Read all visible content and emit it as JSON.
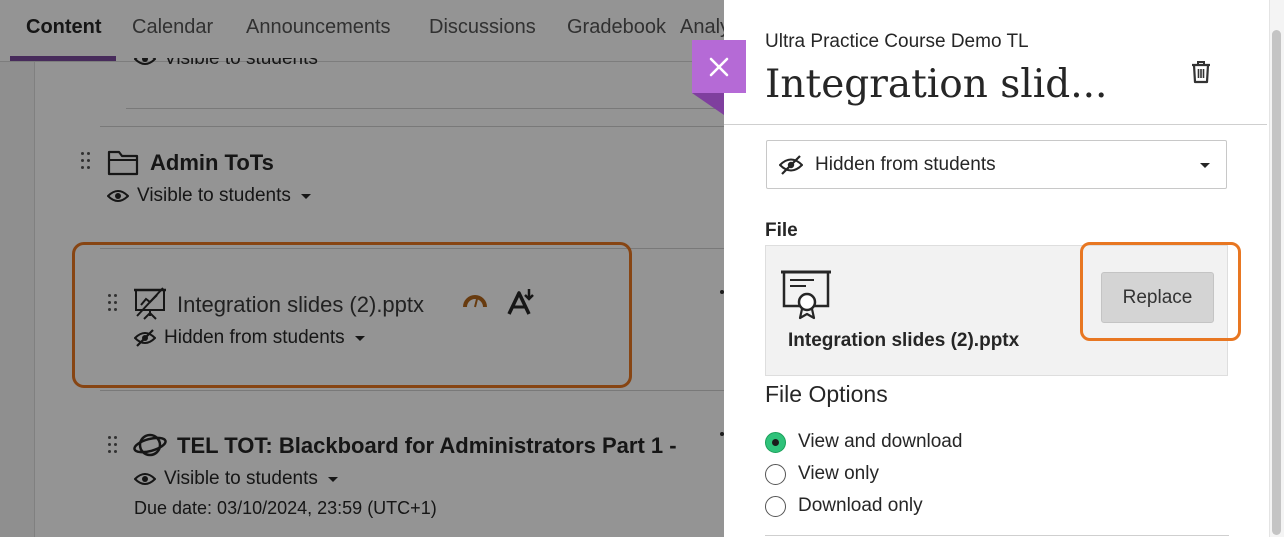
{
  "nav": {
    "tabs": [
      {
        "label": "Content"
      },
      {
        "label": "Calendar"
      },
      {
        "label": "Announcements"
      },
      {
        "label": "Discussions"
      },
      {
        "label": "Gradebook"
      },
      {
        "label": "Analy"
      }
    ]
  },
  "course_items": {
    "top_partial_visibility": "Visible to students",
    "rows": [
      {
        "title": "Admin ToTs",
        "visibility": "Visible to students"
      },
      {
        "title": "Integration slides (2).pptx",
        "visibility": "Hidden from students"
      },
      {
        "title": "TEL TOT: Blackboard for Administrators Part 1 -",
        "visibility": "Visible to students",
        "due": "Due date: 03/10/2024, 23:59 (UTC+1)"
      }
    ]
  },
  "panel": {
    "course_name": "Ultra Practice Course Demo TL",
    "title": "Integration slid...",
    "visibility_value": "Hidden from students",
    "file_label": "File",
    "file_name": "Integration slides (2).pptx",
    "replace_label": "Replace",
    "options_title": "File Options",
    "options": [
      {
        "label": "View and download",
        "checked": true
      },
      {
        "label": "View only",
        "checked": false
      },
      {
        "label": "Download only",
        "checked": false
      }
    ]
  },
  "colors": {
    "accent_purple": "#7a4a9e",
    "close_purple": "#b56ad6",
    "highlight_orange": "#e87722",
    "radio_green": "#2fc27a"
  }
}
